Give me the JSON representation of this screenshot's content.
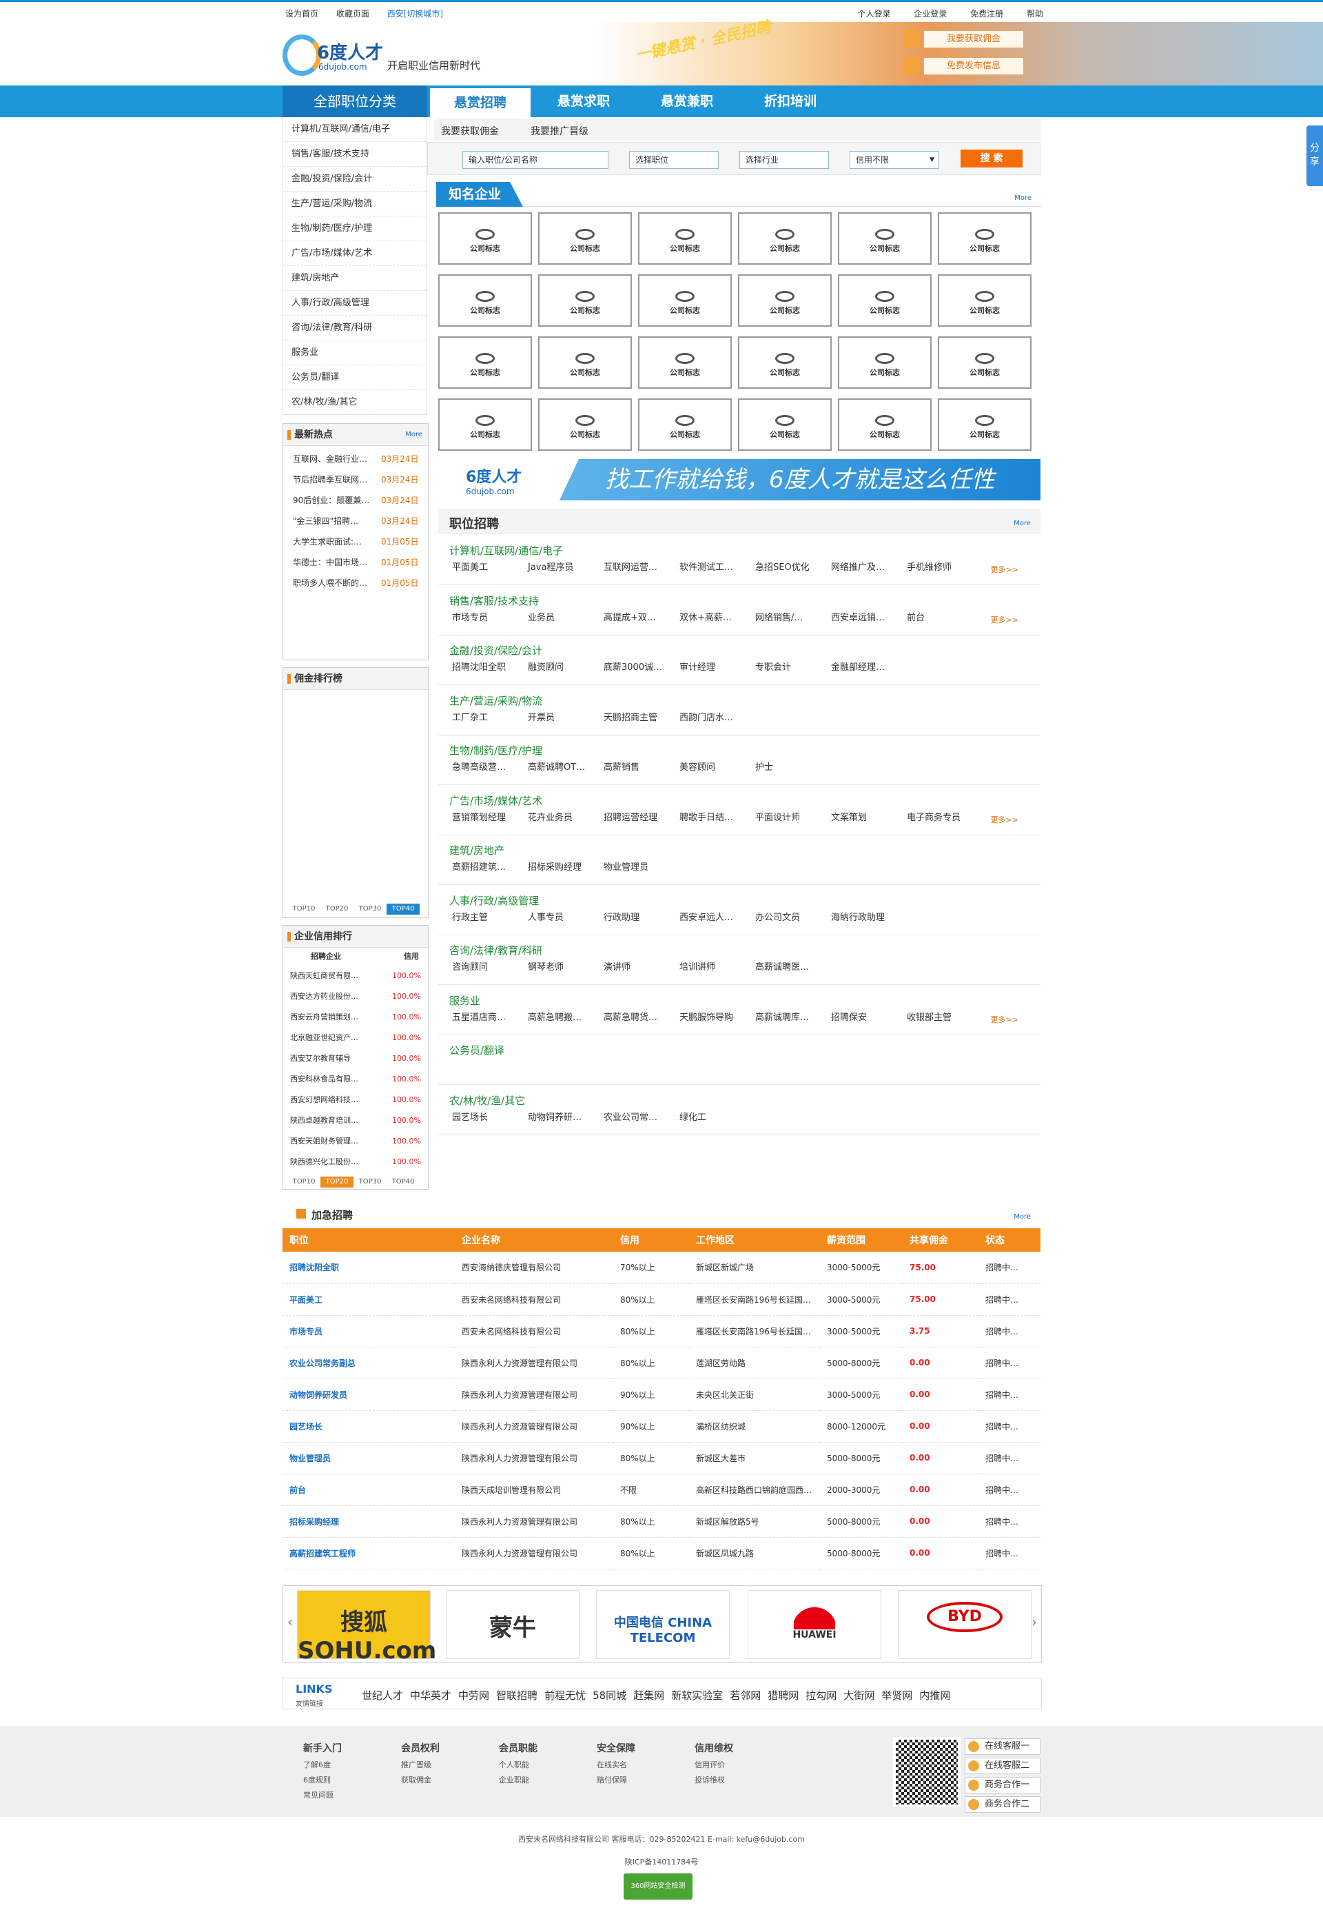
{
  "topbar": {
    "left": [
      "设为首页",
      "收藏页面"
    ],
    "city": "西安[切换城市]",
    "right": [
      "个人登录",
      "企业登录",
      "免费注册",
      "帮助"
    ]
  },
  "header": {
    "logo_name": "6度人才",
    "logo_domain": "6dujob.com",
    "slogan": "开启职业信用新时代",
    "hero_slogan": "一键悬赏 · 全民招聘",
    "btn_commission": "我要获取佣金",
    "btn_post": "免费发布信息"
  },
  "nav": {
    "all": "全部职位分类",
    "tabs": [
      "悬赏招聘",
      "悬赏求职",
      "悬赏兼职",
      "折扣培训"
    ]
  },
  "categories": [
    "计算机/互联网/通信/电子",
    "销售/客服/技术支持",
    "金融/投资/保险/会计",
    "生产/营运/采购/物流",
    "生物/制药/医疗/护理",
    "广告/市场/媒体/艺术",
    "建筑/房地产",
    "人事/行政/高级管理",
    "咨询/法律/教育/科研",
    "服务业",
    "公务员/翻译",
    "农/林/牧/渔/其它"
  ],
  "hot": {
    "title": "最新热点",
    "more": "More",
    "items": [
      {
        "t": "互联网、金融行业…",
        "d": "03月24日"
      },
      {
        "t": "节后招聘季互联网…",
        "d": "03月24日"
      },
      {
        "t": "90后创业：颠覆兼…",
        "d": "03月24日"
      },
      {
        "t": "\"金三银四\"招聘…",
        "d": "03月24日"
      },
      {
        "t": "大学生求职面试:…",
        "d": "01月05日"
      },
      {
        "t": "华德士：中国市场…",
        "d": "01月05日"
      },
      {
        "t": "职场多人喂不断的…",
        "d": "01月05日"
      }
    ]
  },
  "commission_rank": {
    "title": "佣金排行榜",
    "tabs": [
      "TOP10",
      "TOP20",
      "TOP30",
      "TOP40"
    ]
  },
  "credit_rank": {
    "title": "企业信用排行",
    "col1": "招聘企业",
    "col2": "信用",
    "rows": [
      {
        "n": "陕西天虹商贸有限…",
        "v": "100.0%"
      },
      {
        "n": "西安达方药业股份…",
        "v": "100.0%"
      },
      {
        "n": "西安云舟营销策划…",
        "v": "100.0%"
      },
      {
        "n": "北京融亚世纪资产…",
        "v": "100.0%"
      },
      {
        "n": "西安艾尔教育辅导",
        "v": "100.0%"
      },
      {
        "n": "西安科林食品有限…",
        "v": "100.0%"
      },
      {
        "n": "西安幻想网络科技…",
        "v": "100.0%"
      },
      {
        "n": "陕西卓越教育培训…",
        "v": "100.0%"
      },
      {
        "n": "西安天姐财务管理…",
        "v": "100.0%"
      },
      {
        "n": "陕西德兴化工股份…",
        "v": "100.0%"
      }
    ],
    "tabs": [
      "TOP10",
      "TOP20",
      "TOP30",
      "TOP40"
    ]
  },
  "subtabs": [
    "我要获取佣金",
    "我要推广晋级"
  ],
  "search": {
    "keyword": "输入职位/公司名称",
    "job": "选择职位",
    "industry": "选择行业",
    "credit": "信用不限",
    "button": "搜 索"
  },
  "famous": {
    "title": "知名企业",
    "more": "More",
    "logo_label": "公司标志"
  },
  "banner": {
    "name": "6度人才",
    "domain": "6dujob.com",
    "text": "找工作就给钱，6度人才就是这么任性"
  },
  "jobs": {
    "title": "职位招聘",
    "more": "More",
    "more_link": "更多>>",
    "cats": [
      {
        "name": "计算机/互联网/通信/电子",
        "items": [
          "平面美工",
          "Java程序员",
          "互联网运营…",
          "软件测试工…",
          "急招SEO优化",
          "网络推广及…",
          "手机维修师"
        ],
        "more": true
      },
      {
        "name": "销售/客服/技术支持",
        "items": [
          "市场专员",
          "业务员",
          "高提成+双…",
          "双休+高薪…",
          "网络销售/…",
          "西安卓远销…",
          "前台"
        ],
        "more": true
      },
      {
        "name": "金融/投资/保险/会计",
        "items": [
          "招聘沈阳全职",
          "融资顾问",
          "底薪3000诚…",
          "审计经理",
          "专职会计",
          "金融部经理…"
        ],
        "more": false
      },
      {
        "name": "生产/营运/采购/物流",
        "items": [
          "工厂杂工",
          "开票员",
          "天鹏招商主管",
          "西韵门店水…"
        ],
        "more": false
      },
      {
        "name": "生物/制药/医疗/护理",
        "items": [
          "急聘高级营…",
          "高薪诚聘OT…",
          "高薪销售",
          "美容顾问",
          "护士"
        ],
        "more": false
      },
      {
        "name": "广告/市场/媒体/艺术",
        "items": [
          "营销策划经理",
          "花卉业务员",
          "招聘运营经理",
          "聘歌手日结…",
          "平面设计师",
          "文案策划",
          "电子商务专员"
        ],
        "more": true
      },
      {
        "name": "建筑/房地产",
        "items": [
          "高薪招建筑…",
          "招标采购经理",
          "物业管理员"
        ],
        "more": false
      },
      {
        "name": "人事/行政/高级管理",
        "items": [
          "行政主管",
          "人事专员",
          "行政助理",
          "西安卓远人…",
          "办公司文员",
          "海纳行政助理"
        ],
        "more": false
      },
      {
        "name": "咨询/法律/教育/科研",
        "items": [
          "咨询顾问",
          "钢琴老师",
          "演讲师",
          "培训讲师",
          "高薪诚聘医…"
        ],
        "more": false
      },
      {
        "name": "服务业",
        "items": [
          "五星酒店商…",
          "高薪急聘搬…",
          "高薪急聘货…",
          "天鹏服饰导购",
          "高薪诚聘库…",
          "招聘保安",
          "收银部主管"
        ],
        "more": true
      },
      {
        "name": "公务员/翻译",
        "items": [],
        "more": false
      },
      {
        "name": "农/林/牧/渔/其它",
        "items": [
          "园艺场长",
          "动物饲养研…",
          "农业公司常…",
          "绿化工"
        ],
        "more": false
      }
    ]
  },
  "urgent": {
    "title": "加急招聘",
    "more": "More",
    "headers": [
      "职位",
      "企业名称",
      "信用",
      "工作地区",
      "薪资范围",
      "共享佣金",
      "状态"
    ],
    "rows": [
      [
        "招聘沈阳全职",
        "西安海纳德庆管理有限公司",
        "70%以上",
        "新城区新城广场",
        "3000-5000元",
        "75.00",
        "招聘中…"
      ],
      [
        "平面美工",
        "西安未名网络科技有限公司",
        "80%以上",
        "雁塔区长安南路196号长延国…",
        "3000-5000元",
        "75.00",
        "招聘中…"
      ],
      [
        "市场专员",
        "西安未名网络科技有限公司",
        "80%以上",
        "雁塔区长安南路196号长延国…",
        "3000-5000元",
        "3.75",
        "招聘中…"
      ],
      [
        "农业公司常务副总",
        "陕西永利人力资源管理有限公司",
        "80%以上",
        "莲湖区劳动路",
        "5000-8000元",
        "0.00",
        "招聘中…"
      ],
      [
        "动物饲养研发员",
        "陕西永利人力资源管理有限公司",
        "90%以上",
        "未央区北关正街",
        "3000-5000元",
        "0.00",
        "招聘中…"
      ],
      [
        "园艺场长",
        "陕西永利人力资源管理有限公司",
        "90%以上",
        "灞桥区纺织城",
        "8000-12000元",
        "0.00",
        "招聘中…"
      ],
      [
        "物业管理员",
        "陕西永利人力资源管理有限公司",
        "80%以上",
        "新城区大差市",
        "5000-8000元",
        "0.00",
        "招聘中…"
      ],
      [
        "前台",
        "陕西天成培训管理有限公司",
        "不限",
        "高新区科技路西口锦韵庭园西…",
        "2000-3000元",
        "0.00",
        "招聘中…"
      ],
      [
        "招标采购经理",
        "陕西永利人力资源管理有限公司",
        "80%以上",
        "新城区解放路5号",
        "5000-8000元",
        "0.00",
        "招聘中…"
      ],
      [
        "高薪招建筑工程师",
        "陕西永利人力资源管理有限公司",
        "80%以上",
        "新城区凤城九路",
        "5000-8000元",
        "0.00",
        "招聘中…"
      ]
    ]
  },
  "partners": [
    "搜狐 SOHU.com",
    "蒙牛",
    "中国电信 CHINA TELECOM",
    "HUAWEI",
    "BYD"
  ],
  "links": {
    "label": "LINKS",
    "sublabel": "友情链接",
    "items": [
      "世纪人才",
      "中华英才",
      "中劳网",
      "智联招聘",
      "前程无忧",
      "58同城",
      "赶集网",
      "新软实验室",
      "若邻网",
      "猎聘网",
      "拉勾网",
      "大街网",
      "举贤网",
      "内推网"
    ]
  },
  "footer": {
    "cols": [
      {
        "h": "新手入门",
        "i": [
          "了解6度",
          "6度规则",
          "常见问题"
        ]
      },
      {
        "h": "会员权利",
        "i": [
          "推广晋级",
          "获取佣金"
        ]
      },
      {
        "h": "会员职能",
        "i": [
          "个人职能",
          "企业职能"
        ]
      },
      {
        "h": "安全保障",
        "i": [
          "在线实名",
          "赔付保障"
        ]
      },
      {
        "h": "信用维权",
        "i": [
          "信用评价",
          "投诉维权"
        ]
      }
    ],
    "service": [
      "在线客服一",
      "在线客服二",
      "商务合作一",
      "商务合作二"
    ],
    "copyright": "西安未名网络科技有限公司   客服电话：029-85202421   E-mail: kefu@6dujob.com",
    "icp": "陕ICP备14011784号",
    "safe": "360网站安全检测"
  },
  "share": "分享",
  "colors": {
    "primary": "#1e96da",
    "accent": "#f28a1c",
    "category": "#1f8c36"
  }
}
